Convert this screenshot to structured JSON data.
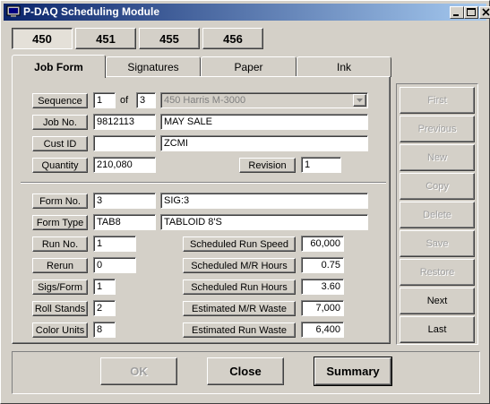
{
  "window": {
    "title": "P-DAQ Scheduling Module"
  },
  "press_buttons": [
    "450",
    "451",
    "455",
    "456"
  ],
  "tabs": [
    "Job Form",
    "Signatures",
    "Paper",
    "Ink"
  ],
  "job": {
    "sequence_label": "Sequence",
    "sequence_value": "1",
    "of_label": "of",
    "sequence_total": "3",
    "press_select": "450  Harris M-3000",
    "job_no_label": "Job No.",
    "job_no": "9812113",
    "job_name": "MAY SALE",
    "cust_id_label": "Cust ID",
    "cust_id": "",
    "cust_name": "ZCMI",
    "quantity_label": "Quantity",
    "quantity": "210,080",
    "revision_label": "Revision",
    "revision": "1"
  },
  "form": {
    "form_no_label": "Form No.",
    "form_no": "3",
    "form_desc": "SIG:3",
    "form_type_label": "Form Type",
    "form_type": "TAB8",
    "form_type_desc": "TABLOID 8'S",
    "run_no_label": "Run No.",
    "run_no": "1",
    "rerun_label": "Rerun",
    "rerun": "0",
    "sigs_label": "Sigs/Form",
    "sigs": "1",
    "roll_label": "Roll Stands",
    "roll": "2",
    "color_label": "Color Units",
    "color": "8",
    "sched_speed_label": "Scheduled Run Speed",
    "sched_speed": "60,000",
    "sched_mr_label": "Scheduled M/R Hours",
    "sched_mr": "0.75",
    "sched_run_label": "Scheduled Run Hours",
    "sched_run": "3.60",
    "est_mr_label": "Estimated M/R Waste",
    "est_mr": "7,000",
    "est_run_label": "Estimated Run Waste",
    "est_run": "6,400"
  },
  "side_buttons": {
    "first": "First",
    "previous": "Previous",
    "new": "New",
    "copy": "Copy",
    "delete": "Delete",
    "save": "Save",
    "restore": "Restore",
    "next": "Next",
    "last": "Last"
  },
  "bottom_buttons": {
    "ok": "OK",
    "close": "Close",
    "summary": "Summary"
  },
  "icons": [
    "app-icon",
    "minimize-icon",
    "maximize-icon",
    "close-icon",
    "dropdown-arrow-icon"
  ],
  "colors": {
    "titlebar_start": "#0a246a",
    "titlebar_end": "#a6caf0",
    "face": "#d4d0c8"
  }
}
